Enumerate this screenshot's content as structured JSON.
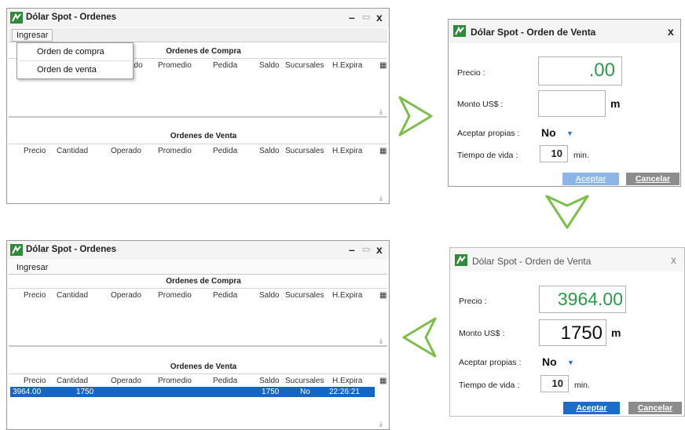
{
  "windows": {
    "orders_top": {
      "title": "Dólar Spot - Ordenes",
      "menu_label": "Ingresar",
      "compra_title": "Ordenes de Compra",
      "venta_title": "Ordenes de Venta",
      "columns": [
        "Precio",
        "Cantidad",
        "Operado",
        "Promedio",
        "Pedida",
        "Saldo",
        "Sucursales",
        "H.Expira"
      ],
      "dropdown": [
        "Orden de compra",
        "Orden de venta"
      ]
    },
    "orders_bottom": {
      "title": "Dólar Spot - Ordenes",
      "menu_label": "Ingresar",
      "compra_title": "Ordenes de Compra",
      "venta_title": "Ordenes de Venta",
      "columns": [
        "Precio",
        "Cantidad",
        "Operado",
        "Promedio",
        "Pedida",
        "Saldo",
        "Sucursales",
        "H.Expira"
      ],
      "venta_row": {
        "precio": "3964.00",
        "cantidad": "1750",
        "saldo": "1750",
        "sucursales": "No",
        "hexpira": "22:26:21"
      }
    },
    "dialog_empty": {
      "title": "Dólar Spot - Orden de Venta",
      "precio_label": "Precio :",
      "precio_value": ".00",
      "monto_label": "Monto US$ :",
      "monto_value": "",
      "monto_unit": "m",
      "propias_label": "Aceptar propias :",
      "propias_value": "No",
      "tiempo_label": "Tiempo de vida :",
      "tiempo_value": "10",
      "tiempo_unit": "min.",
      "accept_label": "Aceptar",
      "cancel_label": "Cancelar"
    },
    "dialog_filled": {
      "title": "Dólar Spot - Orden de Venta",
      "precio_label": "Precio :",
      "precio_value": "3964.00",
      "monto_label": "Monto US$ :",
      "monto_value": "1750",
      "monto_unit": "m",
      "propias_label": "Aceptar propias :",
      "propias_value": "No",
      "tiempo_label": "Tiempo de vida :",
      "tiempo_value": "10",
      "tiempo_unit": "min.",
      "accept_label": "Aceptar",
      "cancel_label": "Cancelar"
    }
  },
  "icons": {
    "app": "dollar-spot-app-icon",
    "close": "close-icon",
    "minimize": "minimize-icon",
    "maximize": "maximize-icon",
    "flow_arrow": "chevron-arrow-icon"
  },
  "colors": {
    "accent": "#1566c4",
    "price_green": "#2c9a4a",
    "arrow_green": "#7bbf4a"
  }
}
